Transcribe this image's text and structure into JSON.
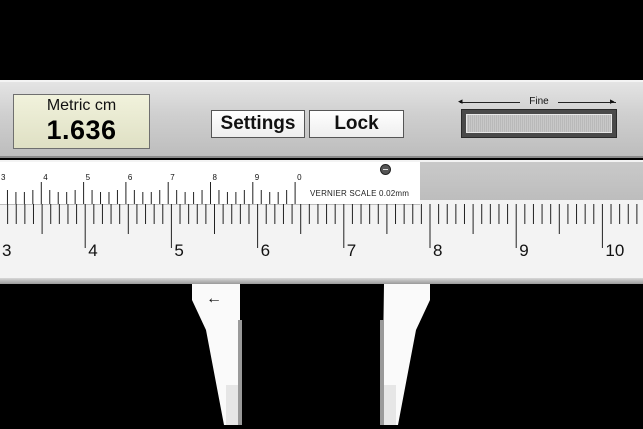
{
  "display": {
    "unit": "Metric cm",
    "value": "1.636"
  },
  "buttons": {
    "settings": "Settings",
    "lock": "Lock"
  },
  "fine_control": {
    "label": "Fine"
  },
  "vernier": {
    "label": "VERNIER SCALE 0.02mm",
    "numbers": [
      "3",
      "4",
      "5",
      "6",
      "7",
      "8",
      "9",
      "0"
    ]
  },
  "main_scale": {
    "numbers": [
      "3",
      "4",
      "5",
      "6",
      "7",
      "8",
      "9",
      "10"
    ]
  },
  "jaw_arrow": "←",
  "colors": {
    "background": "#000000",
    "display": "#e8e9d0",
    "beam": "#f3f3f3"
  }
}
